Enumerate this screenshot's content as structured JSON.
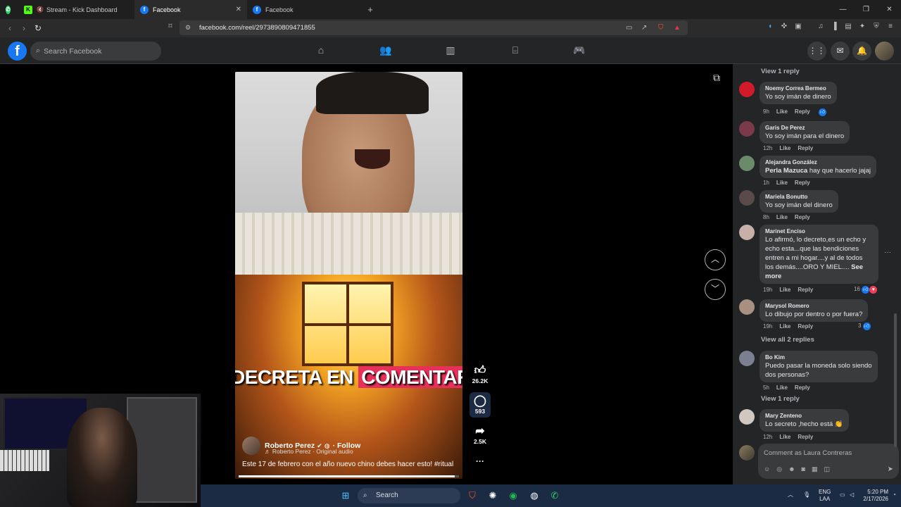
{
  "browser": {
    "tabs": [
      {
        "label": "Stream - Kick Dashboard",
        "favicon": "kick-icon"
      },
      {
        "label": "Facebook",
        "favicon": "facebook-icon",
        "active": true
      },
      {
        "label": "Facebook",
        "favicon": "facebook-icon"
      }
    ],
    "new_tab": "+",
    "url": "facebook.com/reel/2973890809471855"
  },
  "fb_header": {
    "logo": "f",
    "search_placeholder": "Search Facebook"
  },
  "reel": {
    "overlay_text_a": "DECRETA EN ",
    "overlay_text_b": "COMENTARIOS",
    "author": "Roberto Perez",
    "follow": "· Follow",
    "audio": "♬ Roberto Perez · Original audio",
    "caption": "Este 17 de febrero con el año nuevo chino debes hacer esto! #ritual",
    "progress": 0.98,
    "likes": "26.2K",
    "comments": "593",
    "shares": "2.5K",
    "more": "···"
  },
  "comments": {
    "view_1_reply_top": "View 1 reply",
    "items": [
      {
        "name": "Noemy Correa Bermeo",
        "text": "Yo soy imán de dinero",
        "time": "9h",
        "like": "Like",
        "reply": "Reply",
        "reacts": ""
      },
      {
        "name": "Garis De Perez",
        "text": "Yo soy imán para el dinero",
        "time": "12h",
        "like": "Like",
        "reply": "Reply",
        "reacts": ""
      },
      {
        "name": "Alejandra González",
        "mention": "Perla Mazuca",
        "text": " hay que hacerlo jajaj",
        "time": "1h",
        "like": "Like",
        "reply": "Reply",
        "reacts": ""
      },
      {
        "name": "Mariela Bonutto",
        "text": "Yo soy imán del dinero",
        "time": "8h",
        "like": "Like",
        "reply": "Reply",
        "reacts": ""
      },
      {
        "name": "Marinet Enciso",
        "text_lines": [
          "Lo afirmó, lo decreto,es un echo y",
          "echo esta...que las bendiciones",
          "entren a mi hogar....y al de todos",
          "los demás....ORO Y MIEL...."
        ],
        "see_more": "See more",
        "time": "19h",
        "like": "Like",
        "reply": "Reply",
        "reacts": "16"
      },
      {
        "name": "Marysol Romero",
        "text": "Lo dibujo por dentro o por fuera?",
        "time": "19h",
        "like": "Like",
        "reply": "Reply",
        "reacts": "3"
      },
      {
        "name": "Bo Kim",
        "text_lines": [
          "Puedo pasar la moneda solo siendo",
          "dos personas?"
        ],
        "time": "5h",
        "like": "Like",
        "reply": "Reply",
        "reacts": ""
      },
      {
        "name": "Mary Zenteno",
        "text": "Lo secreto ,hecho está 👏",
        "time": "12h",
        "like": "Like",
        "reply": "Reply",
        "reacts": ""
      }
    ],
    "view_all_2_replies": "View all 2 replies",
    "view_1_reply": "View 1 reply",
    "comment_placeholder": "Comment as Laura Contreras"
  },
  "taskbar": {
    "search": "Search",
    "lang_top": "ENG",
    "lang_bottom": "LAA",
    "time": "5:20 PM",
    "date": "2/17/2026"
  },
  "colors": {
    "fb_blue": "#1877f2",
    "panel_bg": "#242526",
    "bubble_bg": "#3a3b3c",
    "highlight_pink": "#e8315a"
  }
}
